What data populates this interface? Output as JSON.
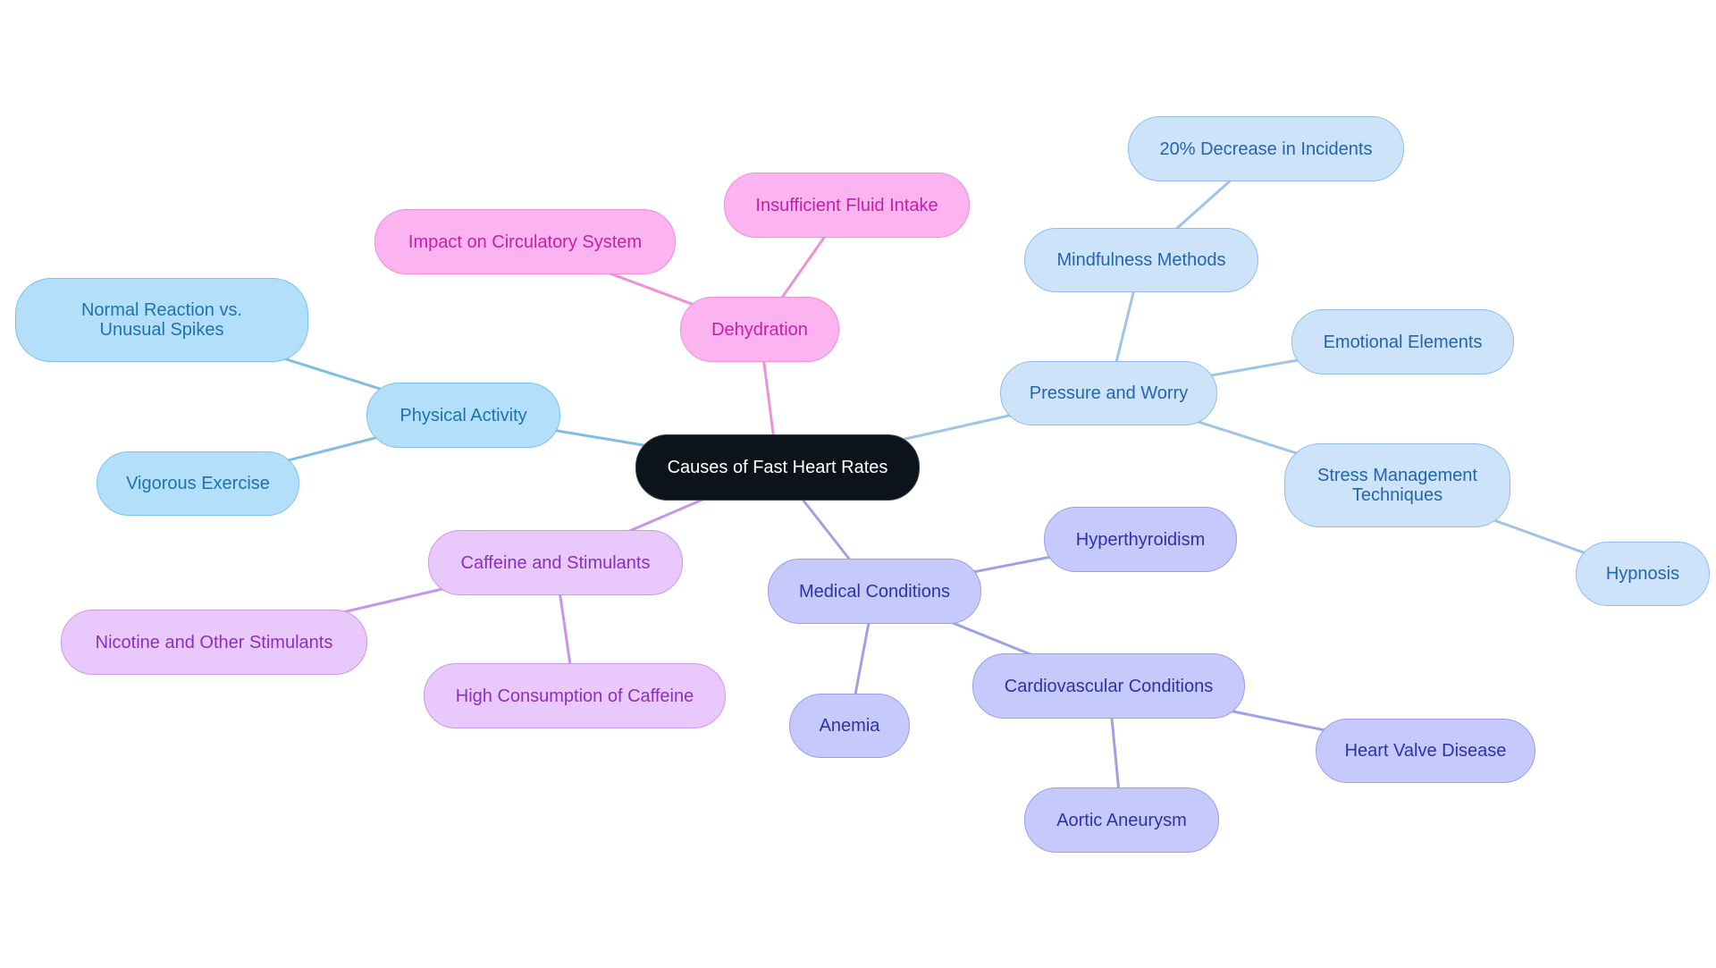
{
  "diagram": {
    "type": "mindmap",
    "root": {
      "id": "root",
      "label": "Causes of Fast Heart Rates"
    },
    "colors": {
      "root_fill": "#0d131b",
      "physical": "#b3dffb",
      "dehydration": "#fcb4f0",
      "pressure": "#cce3fa",
      "caffeine": "#e9c8fc",
      "medical": "#c6c9fc",
      "edge_physical": "#7fbde3",
      "edge_dehydration": "#ea92d8",
      "edge_pressure": "#9fc4e8",
      "edge_caffeine": "#c895e6",
      "edge_medical": "#9da2e4"
    },
    "nodes": [
      {
        "id": "physical",
        "label": "Physical Activity",
        "parent": "root",
        "group": "physical"
      },
      {
        "id": "normal",
        "label": "Normal Reaction vs. Unusual Spikes",
        "parent": "physical",
        "group": "physical"
      },
      {
        "id": "vigorous",
        "label": "Vigorous Exercise",
        "parent": "physical",
        "group": "physical"
      },
      {
        "id": "dehydration",
        "label": "Dehydration",
        "parent": "root",
        "group": "dehydration"
      },
      {
        "id": "impact",
        "label": "Impact on Circulatory System",
        "parent": "dehydration",
        "group": "dehydration"
      },
      {
        "id": "fluid",
        "label": "Insufficient Fluid Intake",
        "parent": "dehydration",
        "group": "dehydration"
      },
      {
        "id": "pressure",
        "label": "Pressure and Worry",
        "parent": "root",
        "group": "pressure"
      },
      {
        "id": "mindfulness",
        "label": "Mindfulness Methods",
        "parent": "pressure",
        "group": "pressure"
      },
      {
        "id": "decrease",
        "label": "20% Decrease in Incidents",
        "parent": "mindfulness",
        "group": "pressure"
      },
      {
        "id": "emotional",
        "label": "Emotional Elements",
        "parent": "pressure",
        "group": "pressure"
      },
      {
        "id": "stress",
        "label": "Stress Management Techniques",
        "parent": "pressure",
        "group": "pressure"
      },
      {
        "id": "hypnosis",
        "label": "Hypnosis",
        "parent": "stress",
        "group": "pressure"
      },
      {
        "id": "caffeine",
        "label": "Caffeine and Stimulants",
        "parent": "root",
        "group": "caffeine"
      },
      {
        "id": "nicotine",
        "label": "Nicotine and Other Stimulants",
        "parent": "caffeine",
        "group": "caffeine"
      },
      {
        "id": "highcaf",
        "label": "High Consumption of Caffeine",
        "parent": "caffeine",
        "group": "caffeine"
      },
      {
        "id": "medical",
        "label": "Medical Conditions",
        "parent": "root",
        "group": "medical"
      },
      {
        "id": "hyperthyroid",
        "label": "Hyperthyroidism",
        "parent": "medical",
        "group": "medical"
      },
      {
        "id": "anemia",
        "label": "Anemia",
        "parent": "medical",
        "group": "medical"
      },
      {
        "id": "cardio",
        "label": "Cardiovascular Conditions",
        "parent": "medical",
        "group": "medical"
      },
      {
        "id": "valve",
        "label": "Heart Valve Disease",
        "parent": "cardio",
        "group": "medical"
      },
      {
        "id": "aortic",
        "label": "Aortic Aneurysm",
        "parent": "cardio",
        "group": "medical"
      }
    ]
  }
}
